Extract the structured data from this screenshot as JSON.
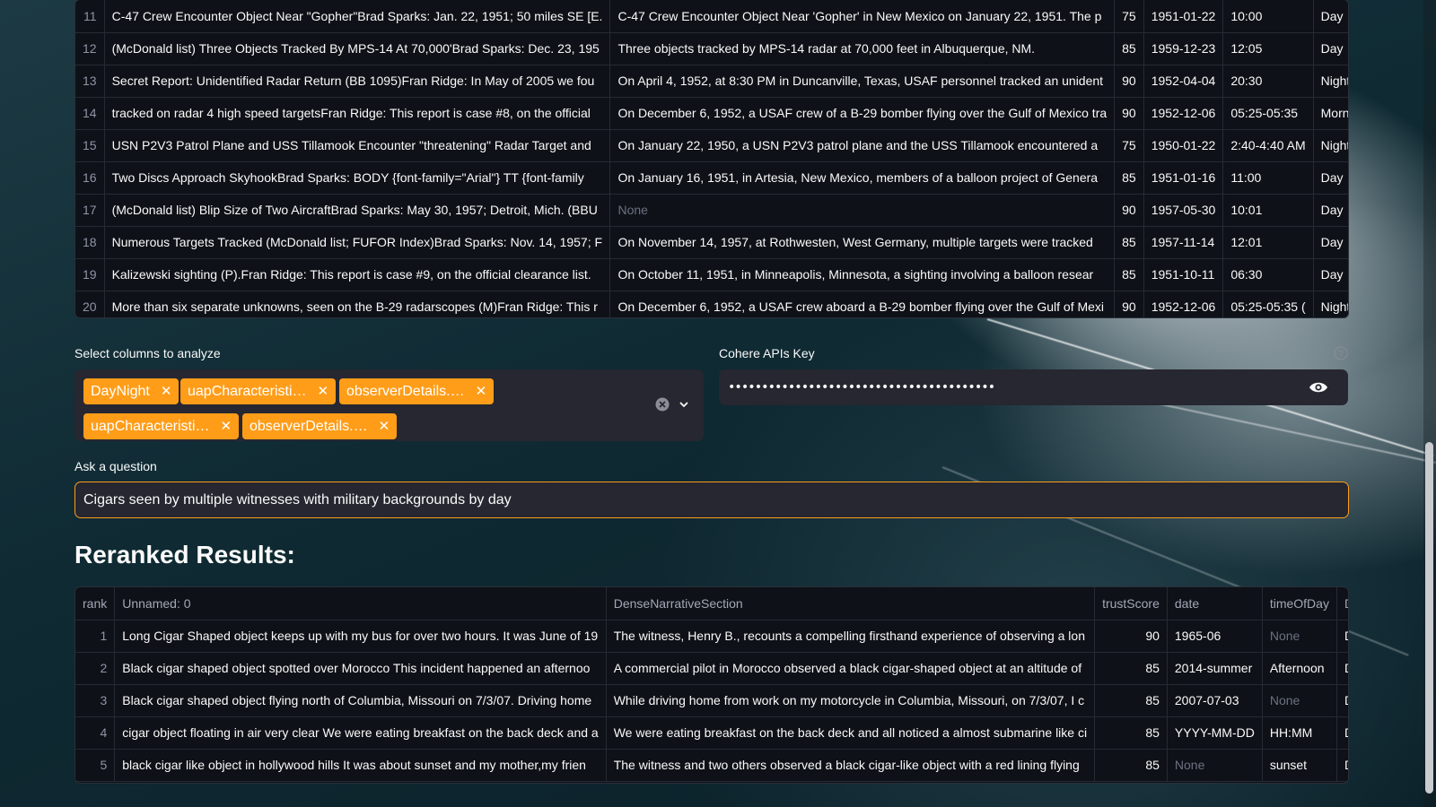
{
  "top_table": {
    "rows": [
      {
        "index": "11",
        "title": "C-47 Crew Encounter Object Near \"Gopher\"Brad Sparks: Jan. 22, 1951; 50 miles SE [E.",
        "narrative": "C-47 Crew Encounter Object Near 'Gopher' in New Mexico on January 22, 1951. The p",
        "score": "75",
        "date": "1951-01-22",
        "time": "10:00",
        "daynight": "Day"
      },
      {
        "index": "12",
        "title": "(McDonald list) Three Objects Tracked By MPS-14 At 70,000'Brad Sparks: Dec. 23, 195",
        "narrative": "Three objects tracked by MPS-14 radar at 70,000 feet in Albuquerque, NM.",
        "score": "85",
        "date": "1959-12-23",
        "time": "12:05",
        "daynight": "Day"
      },
      {
        "index": "13",
        "title": "Secret Report: Unidentified Radar Return (BB 1095)Fran Ridge: In May of 2005 we fou",
        "narrative": "On April 4, 1952, at 8:30 PM in Duncanville, Texas, USAF personnel tracked an unident",
        "score": "90",
        "date": "1952-04-04",
        "time": "20:30",
        "daynight": "Night"
      },
      {
        "index": "14",
        "title": "tracked on radar 4 high speed targetsFran Ridge: This report is case #8, on the official",
        "narrative": "On December 6, 1952, a USAF crew of a B-29 bomber flying over the Gulf of Mexico tra",
        "score": "90",
        "date": "1952-12-06",
        "time": "05:25-05:35",
        "daynight": "Morning"
      },
      {
        "index": "15",
        "title": "USN P2V3 Patrol Plane and USS Tillamook Encounter \"threatening\" Radar Target and",
        "narrative": "On January 22, 1950, a USN P2V3 patrol plane and the USS Tillamook encountered a",
        "score": "75",
        "date": "1950-01-22",
        "time": "2:40-4:40 AM",
        "daynight": "Night"
      },
      {
        "index": "16",
        "title": "Two Discs Approach SkyhookBrad Sparks:  BODY {font-family=\"Arial\"} TT {font-family",
        "narrative": "On January 16, 1951, in Artesia, New Mexico, members of a balloon project of Genera",
        "score": "85",
        "date": "1951-01-16",
        "time": "11:00",
        "daynight": "Day"
      },
      {
        "index": "17",
        "title": "(McDonald list) Blip Size of Two AircraftBrad Sparks: May 30, 1957; Detroit, Mich. (BBU",
        "narrative": "None",
        "score": "90",
        "date": "1957-05-30",
        "time": "10:01",
        "daynight": "Day"
      },
      {
        "index": "18",
        "title": "Numerous Targets Tracked (McDonald list; FUFOR Index)Brad Sparks: Nov. 14, 1957; F",
        "narrative": "On November 14, 1957, at Rothwesten, West Germany, multiple targets were tracked",
        "score": "85",
        "date": "1957-11-14",
        "time": "12:01",
        "daynight": "Day"
      },
      {
        "index": "19",
        "title": "Kalizewski sighting (P).Fran Ridge: This report is case #9, on the official clearance list.",
        "narrative": "On October 11, 1951, in Minneapolis, Minnesota, a sighting involving a balloon resear",
        "score": "85",
        "date": "1951-10-11",
        "time": "06:30",
        "daynight": "Day"
      },
      {
        "index": "20",
        "title": "More than six separate unknowns, seen on the B-29 radarscopes (M)Fran Ridge: This r",
        "narrative": "On December 6, 1952, a USAF crew aboard a B-29 bomber flying over the Gulf of Mexi",
        "score": "90",
        "date": "1952-12-06",
        "time": "05:25-05:35 (",
        "daynight": "Night"
      }
    ]
  },
  "columns_select": {
    "label": "Select columns to analyze",
    "tags": [
      "DayNight",
      "uapCharacteristi…",
      "observerDetails.…",
      "uapCharacteristi…",
      "observerDetails.…"
    ],
    "clear_icon": "clear-circle-icon",
    "dropdown_icon": "chevron-down-icon"
  },
  "api_key": {
    "label": "Cohere APIs Key",
    "value": "••••••••••••••••••••••••••••••••••••••••",
    "help_icon": "question-circle-icon",
    "toggle_icon": "eye-icon"
  },
  "question": {
    "label": "Ask a question",
    "value": "Cigars seen by multiple witnesses with military backgrounds by day"
  },
  "results": {
    "heading": "Reranked Results:",
    "columns": [
      "rank",
      "Unnamed: 0",
      "DenseNarrativeSection",
      "trustScore",
      "date",
      "timeOfDay",
      "DayNigh"
    ],
    "rows": [
      {
        "rank": "1",
        "title": "Long Cigar Shaped object keeps up with my bus for over two hours.  It was June of 19",
        "narrative": "The witness, Henry B., recounts a compelling firsthand experience of observing a lon",
        "score": "90",
        "date": "1965-06",
        "time": "None",
        "daynight": "Day"
      },
      {
        "rank": "2",
        "title": "Black cigar shaped object spotted over Morocco  This incident happened an afternoo",
        "narrative": "A commercial pilot in Morocco observed a black cigar-shaped object at an altitude of",
        "score": "85",
        "date": "2014-summer",
        "time": "Afternoon",
        "daynight": "Day"
      },
      {
        "rank": "3",
        "title": "Black cigar shaped object flying north of Columbia, Missouri on 7/3/07.  Driving home",
        "narrative": "While driving home from work on my motorcycle in Columbia, Missouri, on 7/3/07, I c",
        "score": "85",
        "date": "2007-07-03",
        "time": "None",
        "daynight": "Day"
      },
      {
        "rank": "4",
        "title": "cigar object floating in air very clear  We were eating breakfast on the back deck and a",
        "narrative": "We were eating breakfast on the back deck and all noticed a almost submarine like ci",
        "score": "85",
        "date": "YYYY-MM-DD",
        "time": "HH:MM",
        "daynight": "Day"
      },
      {
        "rank": "5",
        "title": "black cigar like object in hollywood hills  It was about sunset and my mother,my frien",
        "narrative": "The witness and two others observed a black cigar-like object with a red lining flying",
        "score": "85",
        "date": "None",
        "time": "sunset",
        "daynight": "Day"
      }
    ]
  },
  "colors": {
    "accent": "#ff9d19",
    "panel": "#262730",
    "table_bg": "#0e1117"
  }
}
